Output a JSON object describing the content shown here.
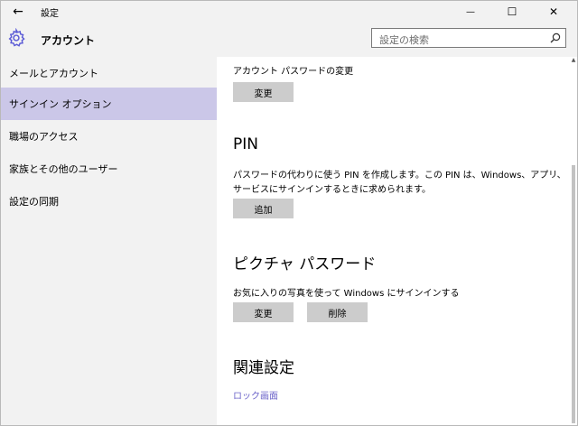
{
  "window": {
    "title": "設定",
    "back_glyph": "←",
    "minimize_glyph": "—",
    "maximize_glyph": "☐",
    "close_glyph": "✕"
  },
  "header": {
    "title": "アカウント",
    "icon": "gear-icon",
    "accent_color": "#5b5bd6"
  },
  "search": {
    "placeholder": "設定の検索",
    "icon": "search-icon"
  },
  "sidebar": {
    "items": [
      {
        "label": "メールとアカウント",
        "active": false
      },
      {
        "label": "サインイン オプション",
        "active": true
      },
      {
        "label": "職場のアクセス",
        "active": false
      },
      {
        "label": "家族とその他のユーザー",
        "active": false
      },
      {
        "label": "設定の同期",
        "active": false
      }
    ],
    "active_color": "#cbc7e8"
  },
  "main": {
    "password": {
      "label": "アカウント パスワードの変更",
      "button": "変更"
    },
    "pin": {
      "heading": "PIN",
      "description_line1": "パスワードの代わりに使う PIN を作成します。この PIN は、Windows、アプリ、",
      "description_line2": "サービスにサインインするときに求められます。",
      "button": "追加"
    },
    "picture_password": {
      "heading": "ピクチャ パスワード",
      "description": "お気に入りの写真を使って Windows にサインインする",
      "change_button": "変更",
      "remove_button": "削除"
    },
    "related": {
      "heading": "関連設定",
      "link": "ロック画面",
      "link_color": "#6b63c9"
    }
  }
}
